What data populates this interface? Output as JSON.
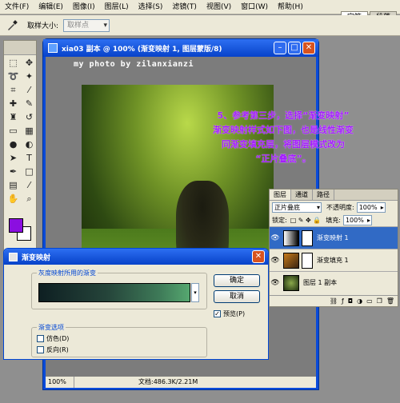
{
  "menu": {
    "items": [
      "文件(F)",
      "编辑(E)",
      "图像(I)",
      "图层(L)",
      "选择(S)",
      "滤镜(T)",
      "视图(V)",
      "窗口(W)",
      "帮助(H)"
    ]
  },
  "palette_tabs": [
    "字符",
    "段落"
  ],
  "options_bar": {
    "sample_size_label": "取样大小:",
    "sample_size_value": "取样点"
  },
  "document": {
    "title": "xia03 副本 @ 100% (渐变映射 1, 图层蒙版/8)",
    "watermark": "my photo by zilanxianzi",
    "zoom": "100%",
    "doc_size": "文档:486.3K/2.21M"
  },
  "annotation": {
    "line1": "5、参考第三步，选择“渐变映射”",
    "line2": "渐变映射样式如下图，也是线性渐变",
    "line3": "同渐变填充层，将图层模式改为",
    "line4": "“正片叠底”。"
  },
  "layers_panel": {
    "tabs": [
      "图层",
      "通道",
      "路径"
    ],
    "blend_mode": "正片叠底",
    "opacity_label": "不透明度:",
    "opacity_value": "100%",
    "lock_label": "锁定:",
    "fill_label": "填充:",
    "fill_value": "100%",
    "layers": [
      {
        "name": "渐变映射 1",
        "selected": true
      },
      {
        "name": "渐变填充 1",
        "selected": false
      },
      {
        "name": "图层 1 副本",
        "selected": false
      }
    ]
  },
  "dialog": {
    "title": "渐变映射",
    "gradient_group_label": "灰度映射所用的渐变",
    "options_group_label": "渐变选项",
    "dither_label": "仿色(D)",
    "reverse_label": "反向(R)",
    "ok_label": "确定",
    "cancel_label": "取消",
    "preview_label": "预览(P)",
    "preview_checked": true,
    "colors": {
      "start": "#0e1f22",
      "end": "#56a870"
    }
  },
  "colors": {
    "foreground": "#8b0fe0",
    "background": "#ffffff",
    "accent": "#0a4bd9",
    "annotation": "#a41cff"
  }
}
